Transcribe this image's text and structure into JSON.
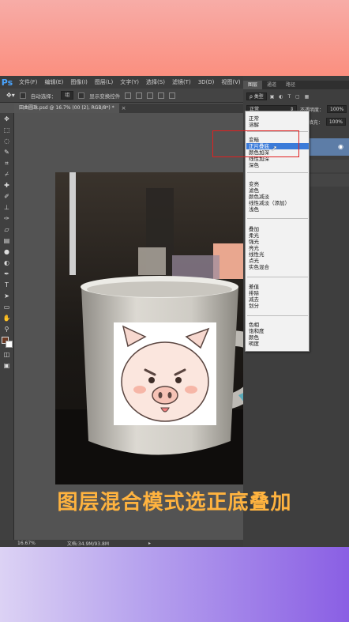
{
  "ps": {
    "logo": "Ps",
    "menu": [
      "文件(F)",
      "编辑(E)",
      "图像(I)",
      "图层(L)",
      "文字(Y)",
      "选择(S)",
      "滤镜(T)",
      "3D(D)",
      "视图(V)"
    ],
    "options": {
      "auto_select_label": "自动选择：",
      "auto_select_value": "组",
      "transform_label": "显示变换控件"
    },
    "doc_tab": "田曲圆珠.psd @ 16.7% (00 (2), RGB/8*) *",
    "status": {
      "zoom": "16.67%",
      "doc": "文档:34.9M/93.8M"
    }
  },
  "panels": {
    "tabs": [
      "图层",
      "通道",
      "路径"
    ],
    "kind_label": "类型",
    "blend_value": "正常",
    "opacity_label": "不透明度：",
    "opacity_value": "100%",
    "fill_label": "填充：",
    "fill_value": "100%"
  },
  "blend_groups": [
    [
      "正常",
      "溶解"
    ],
    [
      "变暗",
      "正片叠底",
      "颜色加深",
      "线性加深",
      "深色"
    ],
    [
      "变亮",
      "滤色",
      "颜色减淡",
      "线性减淡（添加）",
      "浅色"
    ],
    [
      "叠加",
      "柔光",
      "强光",
      "亮光",
      "线性光",
      "点光",
      "实色混合"
    ],
    [
      "差值",
      "排除",
      "减去",
      "划分"
    ],
    [
      "色相",
      "饱和度",
      "颜色",
      "明度"
    ]
  ],
  "highlighted": "正片叠底",
  "caption": "图层混合模式选正底叠加"
}
